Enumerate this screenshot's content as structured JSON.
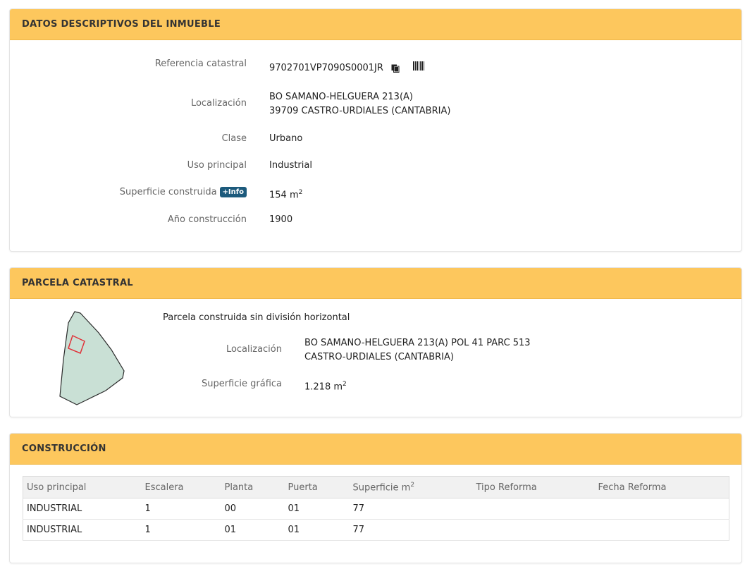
{
  "descriptivos": {
    "title": "DATOS DESCRIPTIVOS DEL INMUEBLE",
    "ref_label": "Referencia catastral",
    "ref_value": "9702701VP7090S0001JR",
    "loc_label": "Localización",
    "loc_line1": "BO SAMANO-HELGUERA 213(A)",
    "loc_line2": "39709 CASTRO-URDIALES (CANTABRIA)",
    "clase_label": "Clase",
    "clase_value": "Urbano",
    "uso_label": "Uso principal",
    "uso_value": "Industrial",
    "sup_label": "Superficie construida",
    "info_badge": "+Info",
    "sup_value": "154 m",
    "sup_unit_exp": "2",
    "anio_label": "Año construcción",
    "anio_value": "1900"
  },
  "parcela": {
    "title": "PARCELA CATASTRAL",
    "tipo": "Parcela construida sin división horizontal",
    "loc_label": "Localización",
    "loc_line1": "BO SAMANO-HELGUERA 213(A) POL 41 PARC 513",
    "loc_line2": "CASTRO-URDIALES (CANTABRIA)",
    "sup_label": "Superficie gráfica",
    "sup_value": "1.218 m",
    "sup_unit_exp": "2",
    "map_fill": "#c9e0d5",
    "map_building": "#e0333a"
  },
  "construccion": {
    "title": "CONSTRUCCIÓN",
    "headers": [
      "Uso principal",
      "Escalera",
      "Planta",
      "Puerta",
      "Superficie m",
      "Tipo Reforma",
      "Fecha Reforma"
    ],
    "sup_header_exp": "2",
    "rows": [
      [
        "INDUSTRIAL",
        "1",
        "00",
        "01",
        "77",
        "",
        ""
      ],
      [
        "INDUSTRIAL",
        "1",
        "01",
        "01",
        "77",
        "",
        ""
      ]
    ]
  },
  "icons": {
    "copy": "copy-icon",
    "barcode": "barcode-icon",
    "map": "parcel-map"
  }
}
